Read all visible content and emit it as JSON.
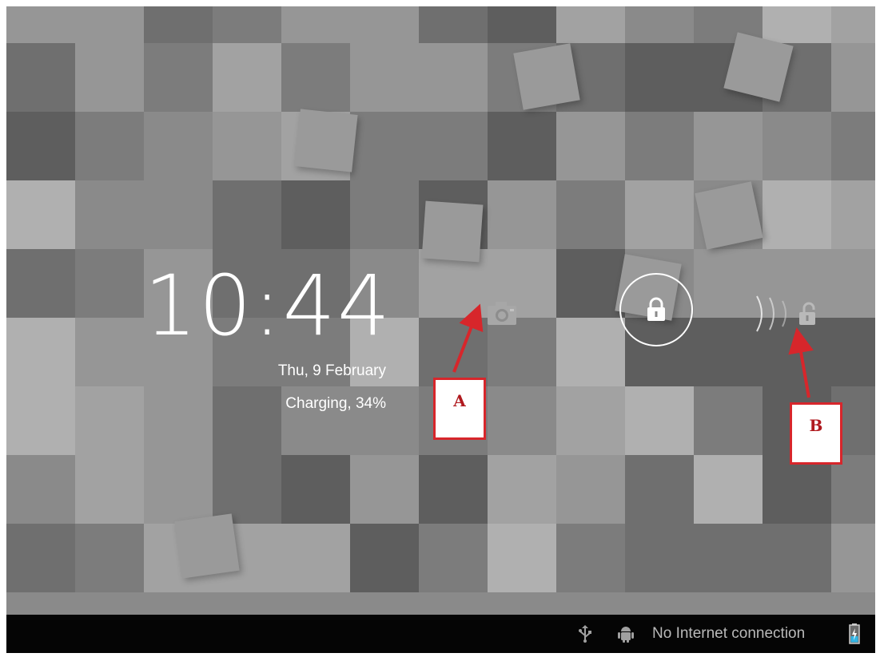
{
  "lockscreen": {
    "time": "10:44",
    "date": "Thu, 9 February",
    "charging_status": "Charging, 34%",
    "camera_icon": "camera-icon",
    "lock_icon": "lock-icon",
    "unlock_icon": "unlock-icon",
    "ring_color": "#ffffff"
  },
  "annotations": {
    "callout_a": "A",
    "callout_b": "B",
    "color": "#d7262b"
  },
  "status_bar": {
    "usb_icon": "usb-icon",
    "debug_icon": "android-debug-icon",
    "connection_text": "No Internet connection",
    "battery_icon": "battery-charging-icon",
    "battery_color": "#33b5e5"
  }
}
